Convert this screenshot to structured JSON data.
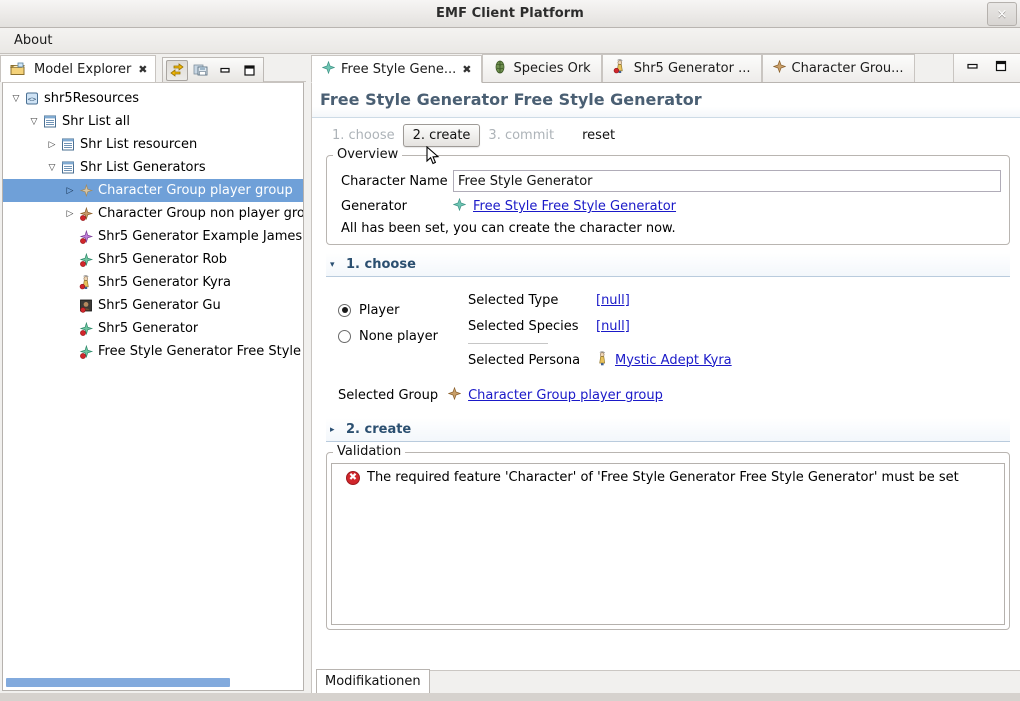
{
  "window": {
    "title": "EMF Client Platform",
    "close_label": "×"
  },
  "menubar": {
    "items": [
      {
        "label": "About",
        "name": "menu-about"
      }
    ]
  },
  "left_view": {
    "tab": {
      "label": "Model Explorer",
      "close_glyph": "✖",
      "icon": "model-explorer-icon"
    },
    "toolbar": [
      {
        "name": "link-with-editor-icon",
        "pressed": true
      },
      {
        "name": "save-icon",
        "pressed": false
      },
      {
        "name": "minimize-icon",
        "pressed": false
      },
      {
        "name": "maximize-icon",
        "pressed": false
      }
    ],
    "tree": [
      {
        "indent": 0,
        "twisty": "down",
        "icon": "resource-set-icon",
        "label": "shr5Resources",
        "selected": false
      },
      {
        "indent": 1,
        "twisty": "down",
        "icon": "list-icon",
        "label": "Shr List all",
        "selected": false
      },
      {
        "indent": 2,
        "twisty": "right",
        "icon": "list-icon",
        "label": "Shr List resourcen",
        "selected": false
      },
      {
        "indent": 2,
        "twisty": "down",
        "icon": "list-icon",
        "label": "Shr List Generators",
        "selected": false
      },
      {
        "indent": 3,
        "twisty": "right",
        "icon": "group-icon",
        "label": "Character Group player group",
        "selected": true
      },
      {
        "indent": 3,
        "twisty": "right",
        "icon": "group-error-icon",
        "label": "Character Group non player gro",
        "selected": false
      },
      {
        "indent": 3,
        "twisty": "none",
        "icon": "generator-purple-icon",
        "label": "Shr5 Generator Example James",
        "selected": false
      },
      {
        "indent": 3,
        "twisty": "none",
        "icon": "generator-icon",
        "label": "Shr5 Generator Rob",
        "selected": false
      },
      {
        "indent": 3,
        "twisty": "none",
        "icon": "persona-icon",
        "label": "Shr5 Generator Kyra",
        "selected": false
      },
      {
        "indent": 3,
        "twisty": "none",
        "icon": "photo-icon",
        "label": "Shr5 Generator Gu",
        "selected": false
      },
      {
        "indent": 3,
        "twisty": "none",
        "icon": "generator-icon",
        "label": "Shr5 Generator",
        "selected": false
      },
      {
        "indent": 3,
        "twisty": "none",
        "icon": "generator-icon",
        "label": "Free Style Generator Free Style",
        "selected": false
      }
    ]
  },
  "editor_tabs": [
    {
      "label": "Free Style Gene...",
      "icon": "diamond-green-icon",
      "active": true,
      "close_glyph": "✖"
    },
    {
      "label": "Species Ork",
      "icon": "species-icon",
      "active": false,
      "close_glyph": ""
    },
    {
      "label": "Shr5 Generator ...",
      "icon": "persona-icon",
      "active": false,
      "close_glyph": ""
    },
    {
      "label": "Character Grou...",
      "icon": "diamond-brown-icon",
      "active": false,
      "close_glyph": ""
    }
  ],
  "editor_tools": [
    {
      "name": "editor-minimize-icon"
    },
    {
      "name": "editor-maximize-icon"
    }
  ],
  "form": {
    "title": "Free Style Generator Free Style Generator",
    "wizard": {
      "steps": [
        {
          "label": "1. choose",
          "state": "done"
        },
        {
          "label": "2. create",
          "state": "current"
        },
        {
          "label": "3. commit",
          "state": "disabled"
        }
      ],
      "reset_label": "reset"
    },
    "overview": {
      "legend": "Overview",
      "character_name_label": "Character Name",
      "character_name_value": "Free Style Generator",
      "character_name_placeholder": "",
      "generator_label": "Generator",
      "generator_link": "Free Style Free Style Generator",
      "generator_icon": "diamond-green-icon",
      "info_text": "All has been set, you can create the character now."
    },
    "section_choose": {
      "title": "1. choose",
      "expanded": true,
      "twisty": "▾",
      "radios": [
        {
          "label": "Player",
          "checked": true
        },
        {
          "label": "None player",
          "checked": false
        }
      ],
      "fields": [
        {
          "label": "Selected Type",
          "value": "[null]",
          "icon": "",
          "is_link": true
        },
        {
          "label": "Selected Species",
          "value": "[null]",
          "icon": "",
          "is_link": true
        },
        {
          "label": "Selected Persona",
          "value": "Mystic Adept Kyra",
          "icon": "persona-icon",
          "is_link": true
        }
      ],
      "group_label": "Selected Group",
      "group_value": "Character Group player group",
      "group_icon": "diamond-brown-icon"
    },
    "section_create": {
      "title": "2. create",
      "expanded": false,
      "twisty": "▸"
    },
    "validation": {
      "legend": "Validation",
      "messages": [
        {
          "icon": "error-icon",
          "text": "The required feature 'Character' of 'Free Style Generator Free Style Generator' must be set"
        }
      ]
    },
    "bottom_tabs": [
      {
        "label": "Modifikationen",
        "active": true
      }
    ]
  },
  "colors": {
    "selection_blue": "#6fa0d8",
    "link_blue": "#1a19c8",
    "title_slate": "#4a5f73",
    "section_blue": "#2b4f70",
    "error_red": "#d1262b",
    "scroll_thumb": "#82aadd"
  }
}
